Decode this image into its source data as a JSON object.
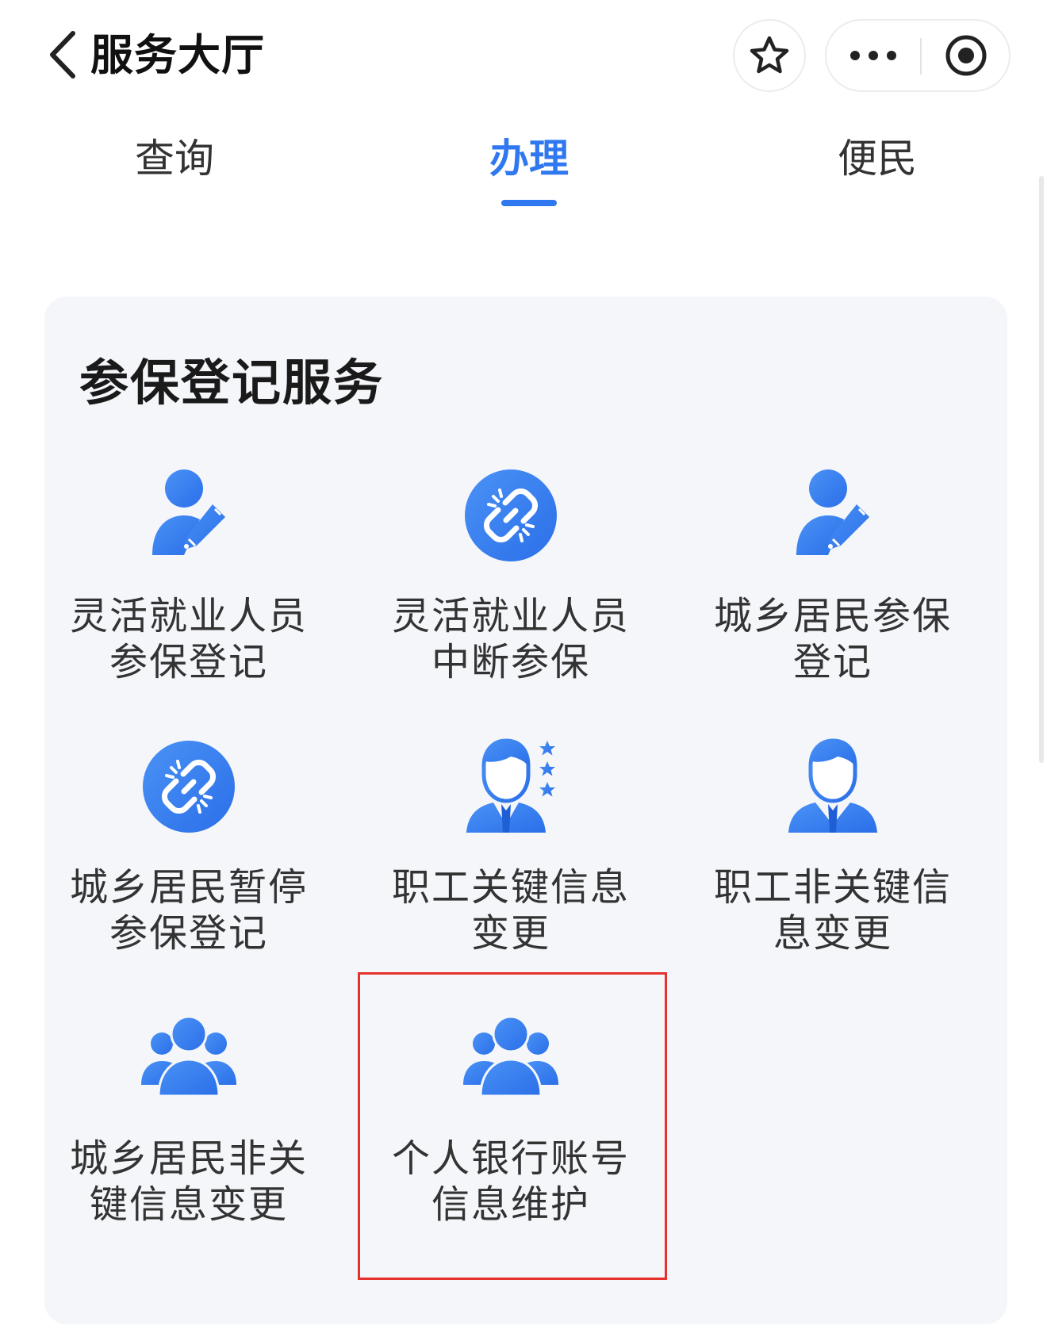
{
  "header": {
    "title": "服务大厅"
  },
  "tabs": [
    {
      "label": "查询",
      "active": false
    },
    {
      "label": "办理",
      "active": true
    },
    {
      "label": "便民",
      "active": false
    }
  ],
  "section": {
    "title": "参保登记服务",
    "items": [
      {
        "label": "灵活就业人员参保登记",
        "icon": "person-edit-icon"
      },
      {
        "label": "灵活就业人员中断参保",
        "icon": "broken-link-icon"
      },
      {
        "label": "城乡居民参保登记",
        "icon": "person-edit-icon"
      },
      {
        "label": "城乡居民暂停参保登记",
        "icon": "broken-link-icon"
      },
      {
        "label": "职工关键信息变更",
        "icon": "employee-stars-icon"
      },
      {
        "label": "职工非关键信息变更",
        "icon": "employee-icon"
      },
      {
        "label": "城乡居民非关键信息变更",
        "icon": "group-icon"
      },
      {
        "label": "个人银行账号信息维护",
        "icon": "group-icon",
        "highlighted": true
      }
    ]
  },
  "colors": {
    "accent": "#2f78f0",
    "icon_blue": "#3d86f2",
    "highlight": "#e5322c",
    "card_bg": "#f4f6fa"
  }
}
